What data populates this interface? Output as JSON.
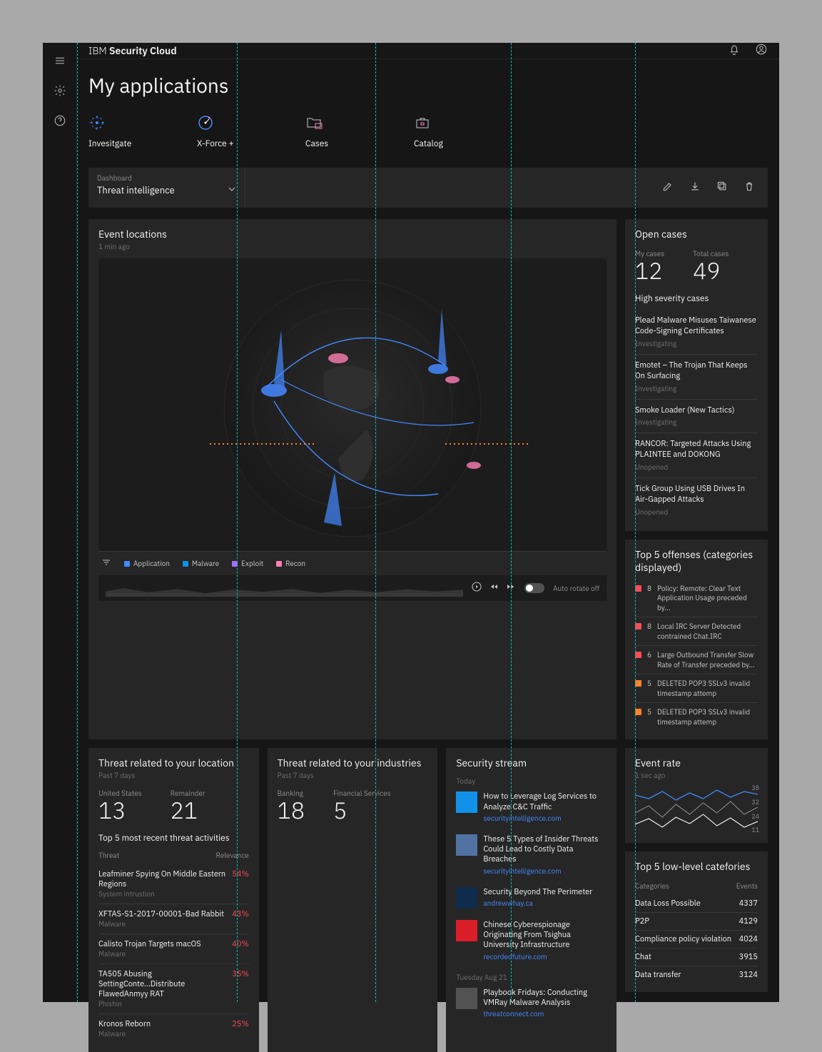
{
  "brand_prefix": "IBM",
  "brand_main": "Security Cloud",
  "page_title": "My applications",
  "apps": [
    {
      "label": "Invesitgate"
    },
    {
      "label": "X-Force +"
    },
    {
      "label": "Cases"
    },
    {
      "label": "Catalog"
    }
  ],
  "dashboard": {
    "label": "Dashboard",
    "value": "Threat intelligence"
  },
  "event_locations": {
    "title": "Event locations",
    "sub": "1 min ago",
    "legend": [
      "Application",
      "Malware",
      "Exploit",
      "Recon"
    ],
    "auto": "Auto rotate off"
  },
  "open_cases": {
    "title": "Open cases",
    "my_label": "My cases",
    "my": "12",
    "total_label": "Total cases",
    "total": "49"
  },
  "high_severity": {
    "title": "High severity cases",
    "items": [
      {
        "t": "Plead Malware Misuses Taiwanese Code-Signing Certificates",
        "s": "Investigating"
      },
      {
        "t": "Emotet – The Trojan That Keeps On Surfacing",
        "s": "Investigating"
      },
      {
        "t": "Smoke Loader (New Tactics)",
        "s": "Investigating"
      },
      {
        "t": "RANCOR: Targeted Attacks Using PLAINTEE and DOKONG",
        "s": "Unopened"
      },
      {
        "t": "Tick Group Using USB Drives In Air-Gapped Attacks",
        "s": "Unopened"
      }
    ]
  },
  "offenses": {
    "title": "Top 5 offenses (categories displayed)",
    "rows": [
      {
        "c": "#fa4d56",
        "n": "8",
        "t": "Policy: Remote: Clear Text Application Usage preceded by..."
      },
      {
        "c": "#fa4d56",
        "n": "8",
        "t": "Local IRC Server Detected contrained Chat.IRC"
      },
      {
        "c": "#fa4d56",
        "n": "6",
        "t": "Large Outbound Transfer Slow Rate of Transfer preceded by..."
      },
      {
        "c": "#ff832b",
        "n": "5",
        "t": "DELETED POP3 SSLv3 invalid timestamp attemp"
      },
      {
        "c": "#ff832b",
        "n": "5",
        "t": "DELETED POP3 SSLv3 invalid timestamp attemp"
      }
    ]
  },
  "threat_loc": {
    "title": "Threat related to your location",
    "sub": "Past 7 days",
    "a_label": "United States",
    "a": "13",
    "b_label": "Remainder",
    "b": "21"
  },
  "threat_ind": {
    "title": "Threat related to your industries",
    "sub": "Past 7 days",
    "a_label": "Banking",
    "a": "18",
    "b_label": "Financial Services",
    "b": "5"
  },
  "recent": {
    "title": "Top 5 most recent threat activities",
    "h1": "Threat",
    "h2": "Relevance",
    "rows": [
      {
        "n": "Leafminer Spying On Middle Eastern Regions",
        "t": "System intrustion",
        "r": "54%"
      },
      {
        "n": "XFTAS-S1-2017-00001-Bad Rabbit",
        "t": "Malware",
        "r": "43%"
      },
      {
        "n": "Calisto Trojan Targets macOS",
        "t": "Malware",
        "r": "40%"
      },
      {
        "n": "TA505 Abusing SettingConte...Distribute FlawedAnmyy RAT",
        "t": "Phishin",
        "r": "35%"
      },
      {
        "n": "Kronos Reborn",
        "t": "Malware",
        "r": "25%"
      }
    ]
  },
  "stream": {
    "title": "Security stream",
    "today": "Today",
    "tue": "Tuesday Aug 21",
    "items_today": [
      {
        "t": "How to Leverage Log Services to Analyze C&C Traffic",
        "s": "securityintelligence.com",
        "c": "#1192e8"
      },
      {
        "t": "These 5 Types of Insider Threats Could Lead to Costly Data Breaches",
        "s": "securityintelligence.com",
        "c": "#5173a3"
      },
      {
        "t": "Security Beyond The Perimeter",
        "s": "andrewwhay.ca",
        "c": "#0f2c4d"
      },
      {
        "t": "Chinese Cyberespionage Originating From Tsighua University Infrastructure",
        "s": "recordedfuture.com",
        "c": "#da1e28"
      }
    ],
    "items_tue": [
      {
        "t": "Playbook Fridays: Conducting VMRay Malware Analysis",
        "s": "threatconnect.com",
        "c": "#525252"
      }
    ]
  },
  "event_rate": {
    "title": "Event rate",
    "sub": "1 sec ago"
  },
  "low_cat": {
    "title": "Top 5 low-level catefories",
    "h1": "Categories",
    "h2": "Events",
    "rows": [
      {
        "n": "Data Loss Possible",
        "v": "4337"
      },
      {
        "n": "P2P",
        "v": "4129"
      },
      {
        "n": "Compliance policy violation",
        "v": "4024"
      },
      {
        "n": "Chat",
        "v": "3915"
      },
      {
        "n": "Data transfer",
        "v": "3124"
      }
    ]
  },
  "chart_data": {
    "type": "line",
    "ylim": [
      0,
      40
    ],
    "yticks": [
      38,
      32,
      24,
      11
    ],
    "series": [
      {
        "name": "blue",
        "values": [
          30,
          28,
          34,
          26,
          33,
          28,
          35,
          30,
          34,
          32
        ]
      },
      {
        "name": "gray",
        "values": [
          20,
          26,
          18,
          28,
          22,
          30,
          24,
          31,
          23,
          27
        ]
      },
      {
        "name": "white",
        "values": [
          12,
          18,
          10,
          20,
          14,
          22,
          12,
          19,
          11,
          16
        ]
      }
    ]
  }
}
